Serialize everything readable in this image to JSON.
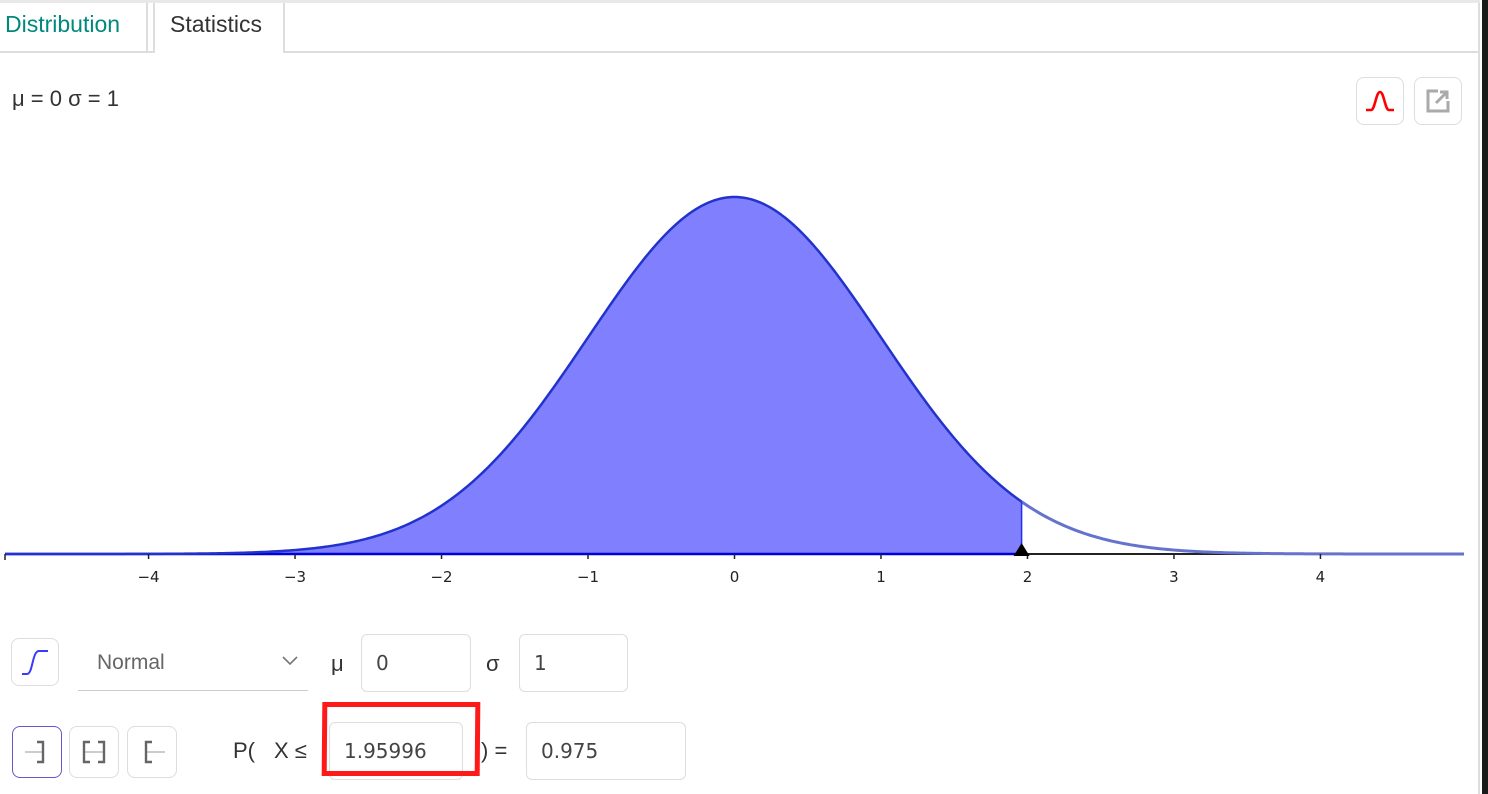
{
  "tabs": [
    {
      "label": "Distribution",
      "active": true
    },
    {
      "label": "Statistics",
      "active": false
    }
  ],
  "header": {
    "params_text": "μ = 0 σ = 1",
    "buttons": [
      {
        "icon": "bell-curve-icon",
        "color": "#ff0000"
      },
      {
        "icon": "export-icon"
      }
    ]
  },
  "chart_data": {
    "type": "area",
    "distribution": "Normal",
    "mu": 0,
    "sigma": 1,
    "xlim": [
      -4.98,
      4.98
    ],
    "xticks": [
      -4,
      -3,
      -2,
      -1,
      0,
      1,
      2,
      3,
      4
    ],
    "xtick_labels": [
      "−4",
      "−3",
      "−2",
      "−1",
      "0",
      "1",
      "2",
      "3",
      "4"
    ],
    "shaded_region": {
      "from": -4.98,
      "to": 1.95996
    },
    "marker_x": 1.95996,
    "fill_color": "#8080ff",
    "curve_color": "#2233cc",
    "tail_color": "#6673cc",
    "grid": false
  },
  "controls": {
    "cdf_toggle_icon": "cumulative-curve-icon",
    "distribution_select": {
      "selected": "Normal"
    },
    "mu_label": "μ",
    "mu_value": "0",
    "sigma_label": "σ",
    "sigma_value": "1",
    "interval_buttons": [
      {
        "icon": "left-sided-icon",
        "selected": true
      },
      {
        "icon": "two-sided-icon",
        "selected": false
      },
      {
        "icon": "right-sided-icon",
        "selected": false
      }
    ],
    "prob_prefix": "P(",
    "prob_var": "X ≤",
    "x_value": "1.95996",
    "prob_suffix": ") =",
    "result": "0.975"
  },
  "annotation": {
    "highlight_color": "#ff1a1a",
    "target": "x-value-input"
  }
}
